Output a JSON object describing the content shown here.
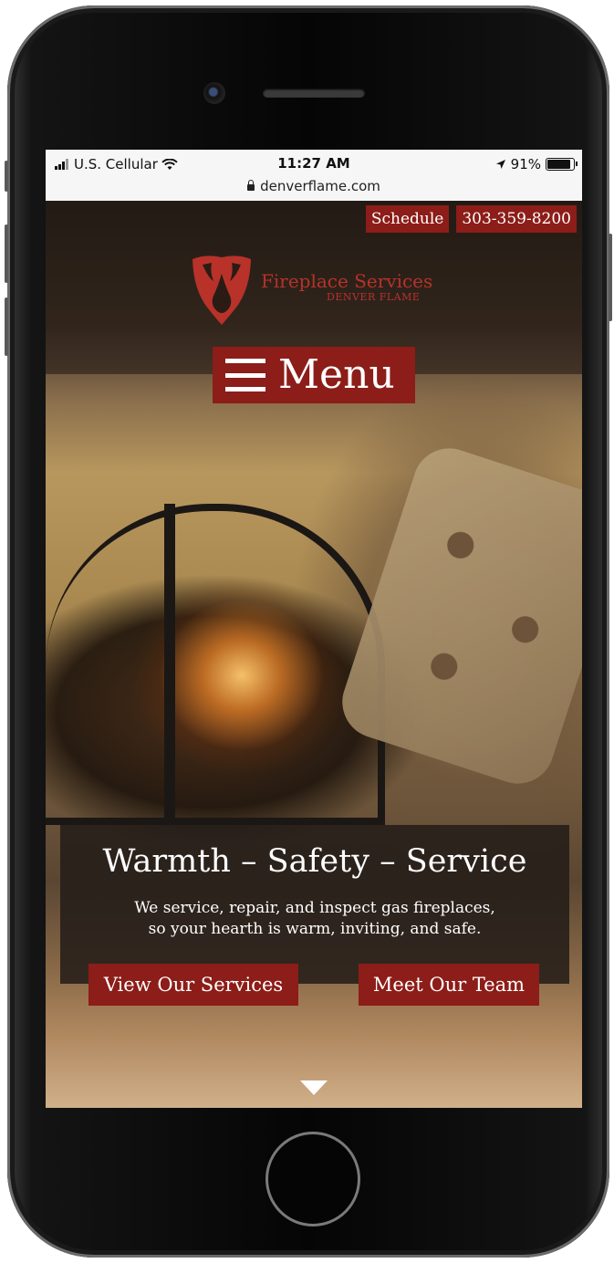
{
  "status_bar": {
    "carrier": "U.S. Cellular",
    "time": "11:27 AM",
    "battery": "91%",
    "url": "denverflame.com"
  },
  "header": {
    "schedule_label": "Schedule",
    "phone_label": "303-359-8200",
    "logo_title": "Fireplace Services",
    "logo_subtitle": "DENVER FLAME",
    "menu_label": "Menu"
  },
  "hero": {
    "headline": "Warmth – Safety – Service",
    "tagline_line1": "We service, repair, and inspect gas fireplaces,",
    "tagline_line2": "so your hearth is warm, inviting, and safe.",
    "cta_services": "View Our Services",
    "cta_team": "Meet Our Team"
  },
  "colors": {
    "brand_red": "#8c1d18",
    "logo_red": "#b8322a"
  },
  "icons": [
    "signal-icon",
    "wifi-icon",
    "location-icon",
    "battery-icon",
    "lock-icon",
    "flame-shield-icon",
    "hamburger-icon",
    "chevron-down-icon"
  ]
}
